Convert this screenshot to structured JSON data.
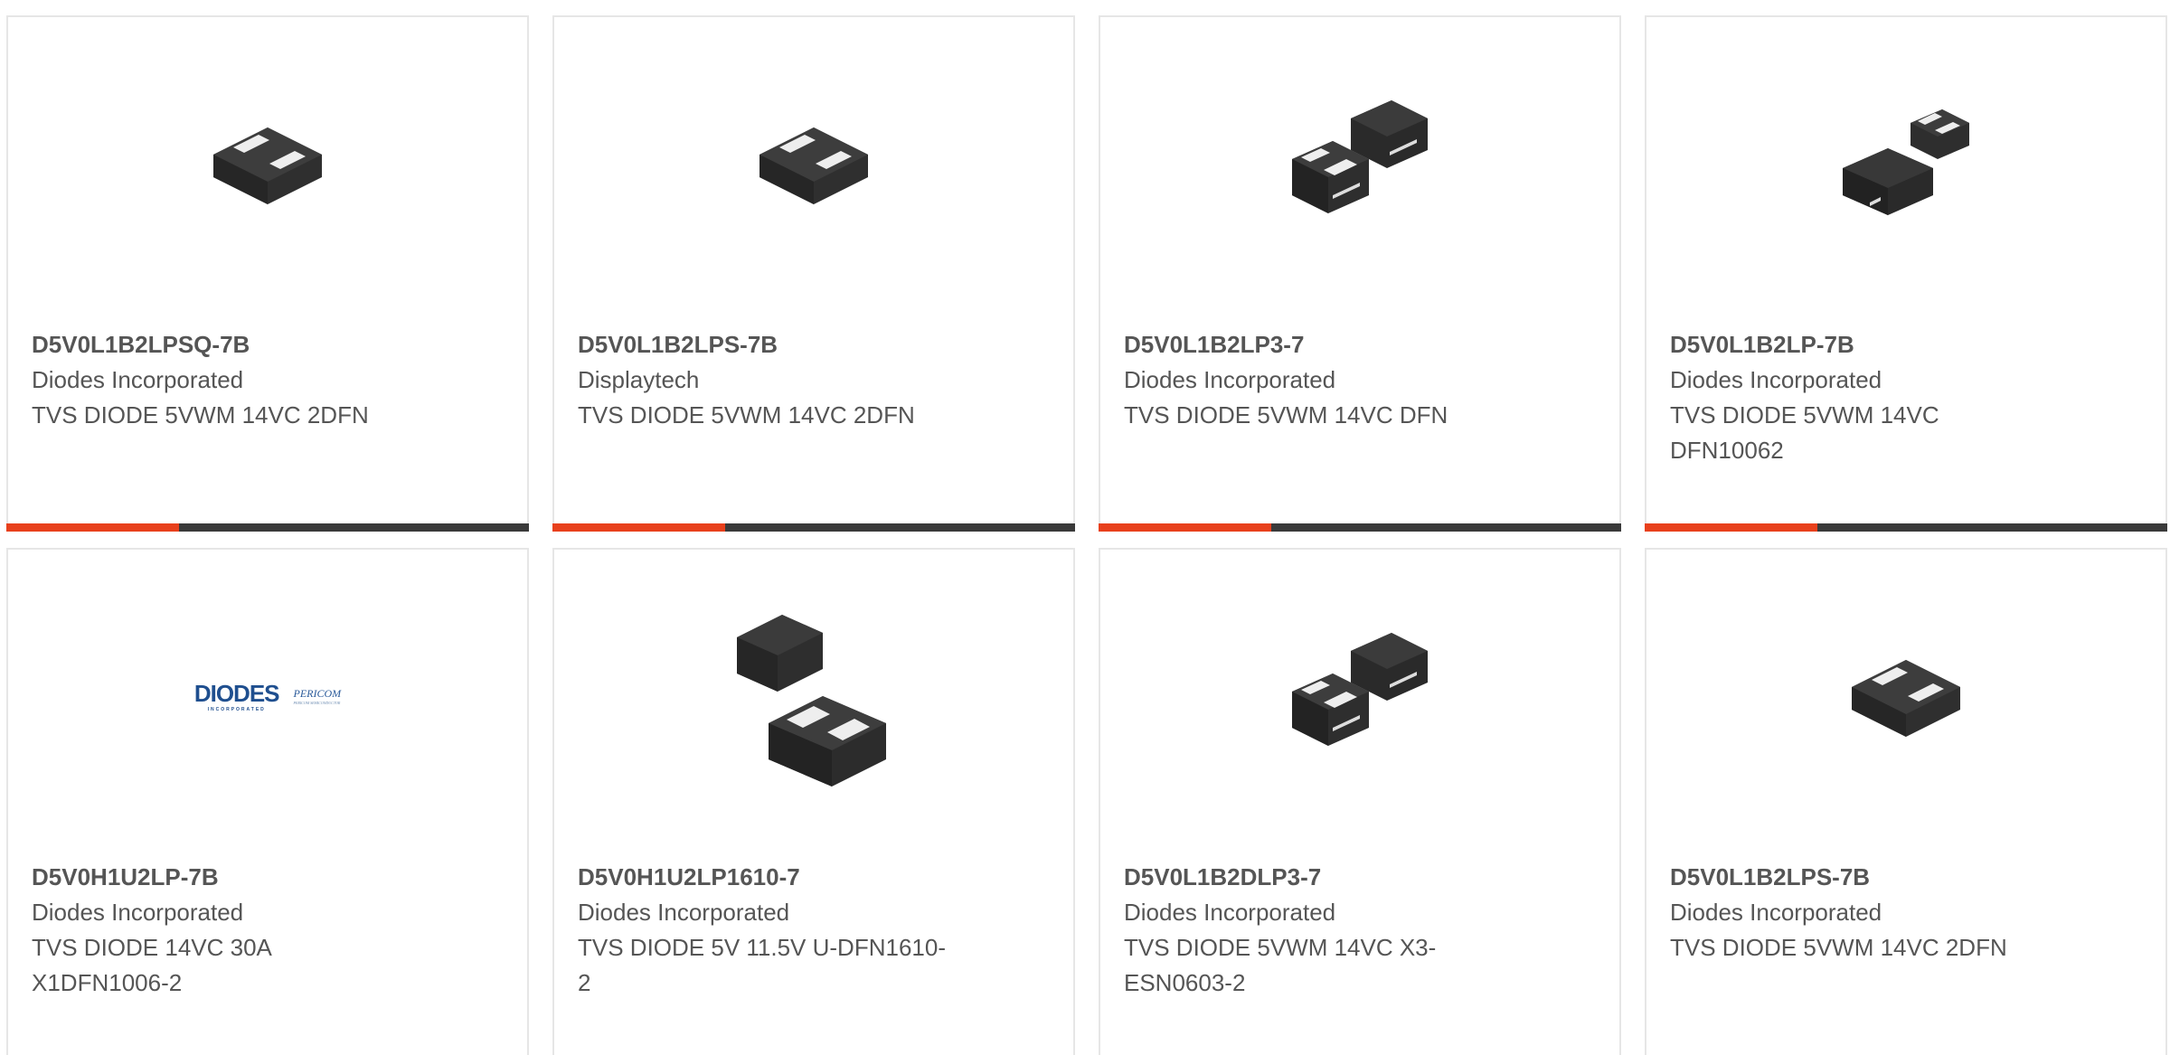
{
  "cards": [
    {
      "part": "D5V0L1B2LPSQ-7B",
      "manufacturer": "Diodes Incorporated",
      "description": "TVS DIODE 5VWM 14VC 2DFN",
      "image": "single-chip-icon",
      "progress": 0.33
    },
    {
      "part": "D5V0L1B2LPS-7B",
      "manufacturer": "Displaytech",
      "description": "TVS DIODE 5VWM 14VC 2DFN",
      "image": "single-chip-icon",
      "progress": 0.33
    },
    {
      "part": "D5V0L1B2LP3-7",
      "manufacturer": "Diodes Incorporated",
      "description": "TVS DIODE 5VWM 14VC DFN",
      "image": "dual-chip-icon",
      "progress": 0.33
    },
    {
      "part": "D5V0L1B2LP-7B",
      "manufacturer": "Diodes Incorporated",
      "description": "TVS DIODE 5VWM 14VC DFN10062",
      "image": "dual-chip-small-icon",
      "progress": 0.33
    },
    {
      "part": "D5V0H1U2LP-7B",
      "manufacturer": "Diodes Incorporated",
      "description": "TVS DIODE 14VC 30A X1DFN1006-2",
      "image": "diodes-pericom-logo",
      "progress": null
    },
    {
      "part": "D5V0H1U2LP1610-7",
      "manufacturer": "Diodes Incorporated",
      "description": "TVS DIODE 5V 11.5V U-DFN1610-2",
      "image": "dual-chip-large-icon",
      "progress": null
    },
    {
      "part": "D5V0L1B2DLP3-7",
      "manufacturer": "Diodes Incorporated",
      "description": "TVS DIODE 5VWM 14VC X3-ESN0603-2",
      "image": "dual-chip-icon",
      "progress": null
    },
    {
      "part": "D5V0L1B2LPS-7B",
      "manufacturer": "Diodes Incorporated",
      "description": "TVS DIODE 5VWM 14VC 2DFN",
      "image": "single-chip-icon",
      "progress": null
    }
  ],
  "logo": {
    "diodes": "DIODES",
    "diodes_sub": "INCORPORATED",
    "pericom": "PERICOM",
    "pericom_sub": "PERICOM SEMICONDUCTOR"
  },
  "colors": {
    "accent": "#e8401c",
    "track": "#3a3a3a",
    "text": "#555555",
    "border": "#e6e6e6"
  }
}
